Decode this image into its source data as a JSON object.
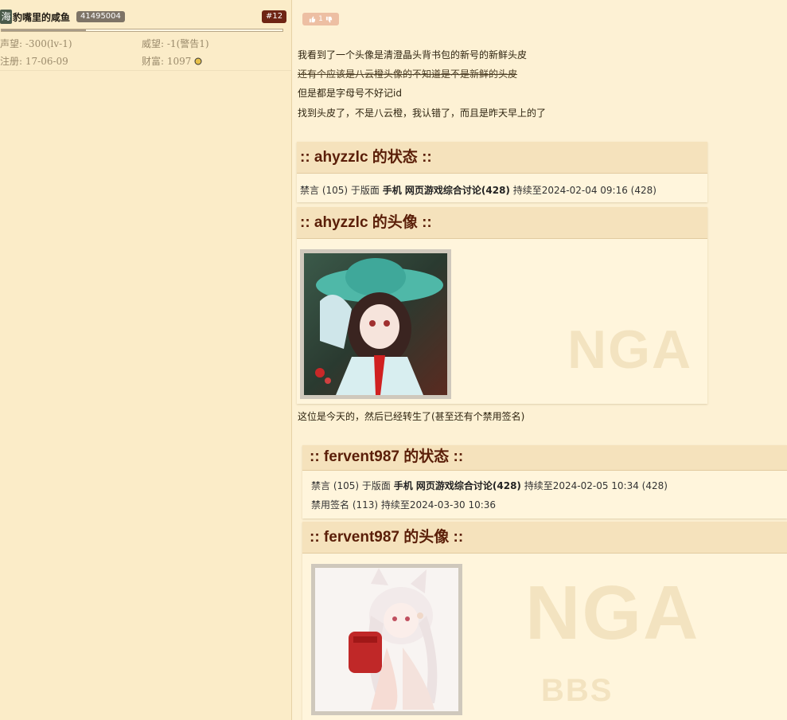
{
  "sidebar": {
    "avatar_char": "海",
    "username": "豹嘴里的咸鱼",
    "uid": "41495004",
    "floor": "#12",
    "reputation_label": "声望:",
    "reputation_value": "-300(lv-1)",
    "prestige_label": "威望:",
    "prestige_value": "-1(警告1)",
    "register_label": "注册:",
    "register_value": "17-06-09",
    "wealth_label": "财富:",
    "wealth_value": "1097",
    "level_progress": 0.3
  },
  "post": {
    "like_count": "1",
    "lines": [
      "我看到了一个头像是清澄晶头背书包的新号的新鲜头皮",
      "还有个应该是八云橙头像的不知道是不是新鲜的头皮",
      "但是都是字母号不好记id",
      "找到头皮了，不是八云橙，我认错了，而且是昨天早上的了"
    ],
    "between_text": "这位是今天的，然后已经转生了(甚至还有个禁用签名)"
  },
  "user1": {
    "status_title": ":: ahyzzlc 的状态 ::",
    "status_lines": [
      {
        "prefix": "禁言 (105) 于版面 ",
        "bold": "手机 网页游戏综合讨论(428)",
        "suffix": " 持续至2024-02-04 09:16 (428)"
      }
    ],
    "avatar_title": ":: ahyzzlc 的头像 ::"
  },
  "user2": {
    "status_title": ":: fervent987 的状态 ::",
    "status_lines": [
      {
        "prefix": "禁言 (105) 于版面 ",
        "bold": "手机 网页游戏综合讨论(428)",
        "suffix": " 持续至2024-02-05 10:34 (428)"
      },
      {
        "prefix": "禁用签名 (113) 持续至2024-03-30 10:36",
        "bold": "",
        "suffix": ""
      }
    ],
    "avatar_title": ":: fervent987 的头像 ::"
  },
  "icons": {
    "like": "thumbs-up-icon",
    "dislike": "thumbs-down-icon",
    "coin": "coin-icon"
  },
  "colors": {
    "page_bg": "#fdf1d4",
    "header_text": "#5a1e08",
    "floor_badge": "#6e2414"
  }
}
